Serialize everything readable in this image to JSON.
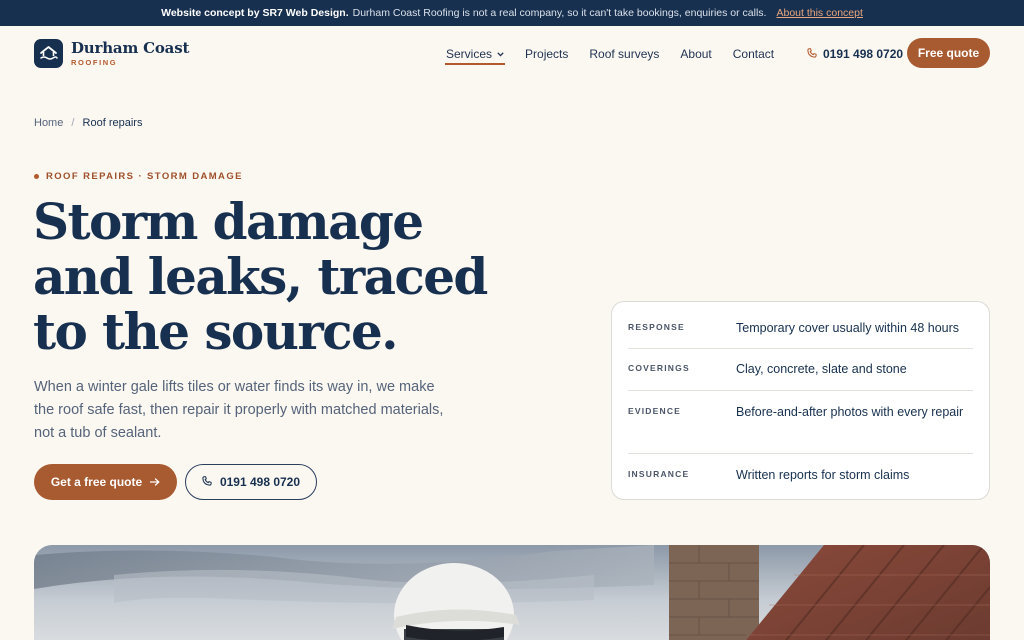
{
  "banner": {
    "bold": "Website concept by SR7 Web Design.",
    "text": "Durham Coast Roofing is not a real company, so it can't take bookings, enquiries or calls.",
    "link": "About this concept"
  },
  "brand": {
    "name": "Durham Coast",
    "sub": "ROOFING"
  },
  "nav": {
    "items": [
      {
        "label": "Services",
        "active": true
      },
      {
        "label": "Projects"
      },
      {
        "label": "Roof surveys"
      },
      {
        "label": "About"
      },
      {
        "label": "Contact"
      }
    ],
    "phone": "0191 498 0720",
    "quote": "Free quote"
  },
  "breadcrumb": {
    "home": "Home",
    "sep": "/",
    "current": "Roof repairs"
  },
  "hero": {
    "eyebrow": "ROOF REPAIRS · STORM DAMAGE",
    "title_lines": [
      "Storm damage",
      "and leaks, traced",
      "to the source."
    ],
    "lede": "When a winter gale lifts tiles or water finds its way in, we make the roof safe fast, then repair it properly with matched materials, not a tub of sealant.",
    "cta_primary": "Get a free quote",
    "cta_secondary": "0191 498 0720"
  },
  "facts": [
    {
      "key": "RESPONSE",
      "value": "Temporary cover usually within 48 hours"
    },
    {
      "key": "COVERINGS",
      "value": "Clay, concrete, slate and stone"
    },
    {
      "key": "EVIDENCE",
      "value": "Before-and-after photos with every repair"
    },
    {
      "key": "INSURANCE",
      "value": "Written reports for storm claims"
    }
  ],
  "colors": {
    "navy": "#17304f",
    "accent": "#a85a30",
    "background": "#fbf7f1"
  },
  "icons": {
    "logo": "house-wave-icon",
    "phone": "phone-icon",
    "chevron": "chevron-down-icon",
    "arrow": "arrow-right-icon"
  }
}
